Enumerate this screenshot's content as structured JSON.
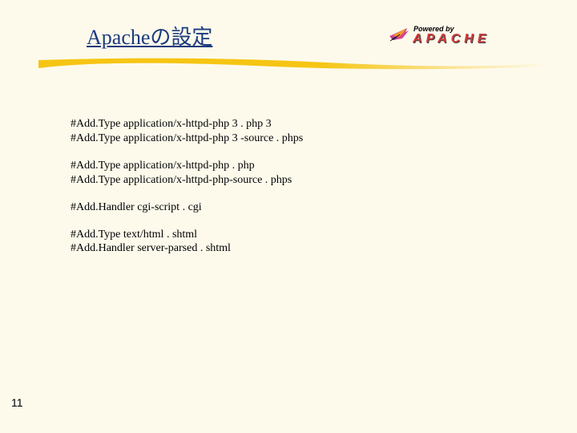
{
  "title": "Apacheの設定",
  "lines": {
    "l1": "#Add.Type application/x-httpd-php 3 . php 3",
    "l2": "#Add.Type application/x-httpd-php 3 -source . phps",
    "l3": "#Add.Type application/x-httpd-php . php",
    "l4": "#Add.Type application/x-httpd-php-source . phps",
    "l5": "#Add.Handler cgi-script . cgi",
    "l6": "#Add.Type text/html . shtml",
    "l7": "#Add.Handler server-parsed . shtml"
  },
  "page_number": "11",
  "logo": {
    "powered_by": "Powered by",
    "brand": "APACHE"
  }
}
